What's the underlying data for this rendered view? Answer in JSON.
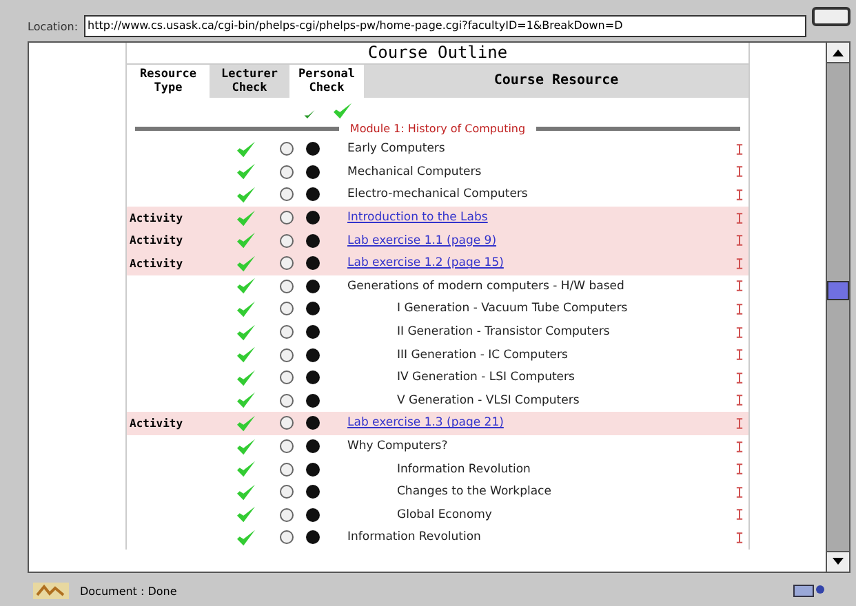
{
  "location": {
    "label": "Location:",
    "value": "http://www.cs.usask.ca/cgi-bin/phelps-cgi/phelps-pw/home-page.cgi?facultyID=1&BreakDown=D"
  },
  "outline": {
    "title": "Course Outline",
    "columns": [
      {
        "label": "Resource Type",
        "shaded": false
      },
      {
        "label": "Lecturer Check",
        "shaded": true
      },
      {
        "label": "Personal Check",
        "shaded": false
      },
      {
        "label": "Course Resource",
        "shaded": true
      }
    ],
    "module": "Module 1: History of Computing",
    "rows": [
      {
        "kind": "topic",
        "title": "Early Computers",
        "lecturer_check": true,
        "personal_check": true
      },
      {
        "kind": "topic",
        "title": "Mechanical Computers",
        "lecturer_check": true,
        "personal_check": true
      },
      {
        "kind": "topic",
        "title": "Electro-mechanical Computers",
        "lecturer_check": true,
        "personal_check": true
      },
      {
        "kind": "activity",
        "type": "Activity",
        "title": "Introduction to the Labs",
        "lecturer_check": true,
        "personal_check": true
      },
      {
        "kind": "activity",
        "type": "Activity",
        "title": "Lab exercise 1.1 (page 9)",
        "lecturer_check": true,
        "personal_check": true
      },
      {
        "kind": "activity",
        "type": "Activity",
        "title": "Lab exercise 1.2 (page 15)",
        "lecturer_check": true,
        "personal_check": true
      },
      {
        "kind": "topic",
        "title": "Generations of modern computers - H/W based",
        "lecturer_check": true,
        "personal_check": true,
        "children": [
          {
            "kind": "topic",
            "title": "I Generation - Vacuum Tube Computers",
            "lecturer_check": true,
            "personal_check": true
          },
          {
            "kind": "topic",
            "title": "II Generation - Transistor Computers",
            "lecturer_check": true,
            "personal_check": true
          },
          {
            "kind": "topic",
            "title": "III Generation - IC Computers",
            "lecturer_check": true,
            "personal_check": true
          },
          {
            "kind": "topic",
            "title": "IV Generation - LSI Computers",
            "lecturer_check": true,
            "personal_check": true
          },
          {
            "kind": "topic",
            "title": "V Generation - VLSI Computers",
            "lecturer_check": true,
            "personal_check": true
          }
        ]
      },
      {
        "kind": "activity",
        "type": "Activity",
        "title": "Lab exercise 1.3 (page 21)",
        "lecturer_check": true,
        "personal_check": true
      },
      {
        "kind": "topic",
        "title": "Why Computers?",
        "lecturer_check": true,
        "personal_check": true,
        "children": [
          {
            "kind": "topic",
            "title": "Information Revolution",
            "lecturer_check": true,
            "personal_check": true
          },
          {
            "kind": "topic",
            "title": "Changes to the Workplace",
            "lecturer_check": true,
            "personal_check": true
          },
          {
            "kind": "topic",
            "title": "Global Economy",
            "lecturer_check": true,
            "personal_check": true
          }
        ]
      },
      {
        "kind": "topic",
        "title": "Information Revolution",
        "lecturer_check": true,
        "personal_check": true
      }
    ]
  },
  "status_bar": {
    "text": "Document : Done"
  }
}
